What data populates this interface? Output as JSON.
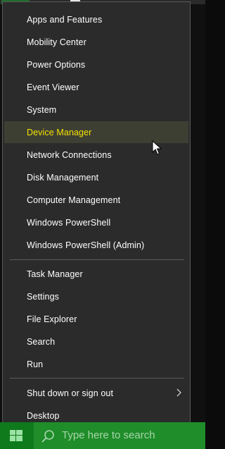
{
  "menu": {
    "items": [
      {
        "label": "Apps and Features"
      },
      {
        "label": "Mobility Center"
      },
      {
        "label": "Power Options"
      },
      {
        "label": "Event Viewer"
      },
      {
        "label": "System"
      },
      {
        "label": "Device Manager",
        "highlighted": true
      },
      {
        "label": "Network Connections"
      },
      {
        "label": "Disk Management"
      },
      {
        "label": "Computer Management"
      },
      {
        "label": "Windows PowerShell"
      },
      {
        "label": "Windows PowerShell (Admin)"
      },
      {
        "label": "Task Manager"
      },
      {
        "label": "Settings"
      },
      {
        "label": "File Explorer"
      },
      {
        "label": "Search"
      },
      {
        "label": "Run"
      },
      {
        "label": "Shut down or sign out",
        "has_submenu": true
      },
      {
        "label": "Desktop"
      }
    ],
    "highlight_color": "#f6e200",
    "background_color": "#2b2b2b"
  },
  "taskbar": {
    "search_placeholder": "Type here to search",
    "accent_color": "#1f8d2a"
  }
}
